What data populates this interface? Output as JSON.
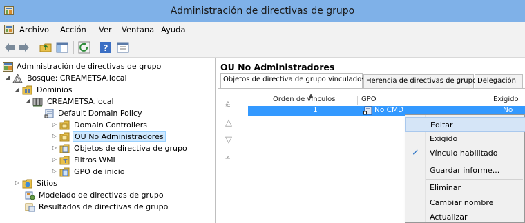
{
  "window": {
    "title": "Administración de directivas de grupo"
  },
  "menu": [
    "Archivo",
    "Acción",
    "Ver",
    "Ventana",
    "Ayuda"
  ],
  "toolbar": {
    "icons": [
      "back-arrow-icon",
      "forward-arrow-icon",
      "up-folder-icon",
      "show-hide-tree-icon",
      "refresh-icon",
      "help-icon",
      "properties-icon"
    ]
  },
  "tree": {
    "root": "Administración de directivas de grupo",
    "forest": "Bosque: CREAMETSA.local",
    "domains": "Dominios",
    "domain": "CREAMETSA.local",
    "items": [
      "Default Domain Policy",
      "Domain Controllers",
      "OU No Administradores",
      "Objetos de directiva de grupo",
      "Filtros WMI",
      "GPO de inicio"
    ],
    "sites": "Sitios",
    "modeling": "Modelado de directivas de grupo",
    "results": "Resultados de directivas de grupo"
  },
  "details": {
    "heading": "OU No Administradores",
    "tabs": [
      "Objetos de directiva de grupo vinculados",
      "Herencia de directivas de grupo",
      "Delegación"
    ],
    "columns": [
      "Orden de vínculos",
      "GPO",
      "Exigido"
    ],
    "rows": [
      {
        "order": "1",
        "gpo": "No CMD",
        "enforced": "No"
      }
    ]
  },
  "context_menu": {
    "items": [
      "Editar",
      "Exigido",
      "Vínculo habilitado",
      "Guardar informe...",
      "Eliminar",
      "Cambiar nombre",
      "Actualizar"
    ],
    "checked_item": "Vínculo habilitado",
    "highlighted_item": "Editar"
  },
  "colors": {
    "titlebar": "#7fb1e8",
    "selection": "#3399ff",
    "menu_highlight": "#d5e5f7"
  }
}
